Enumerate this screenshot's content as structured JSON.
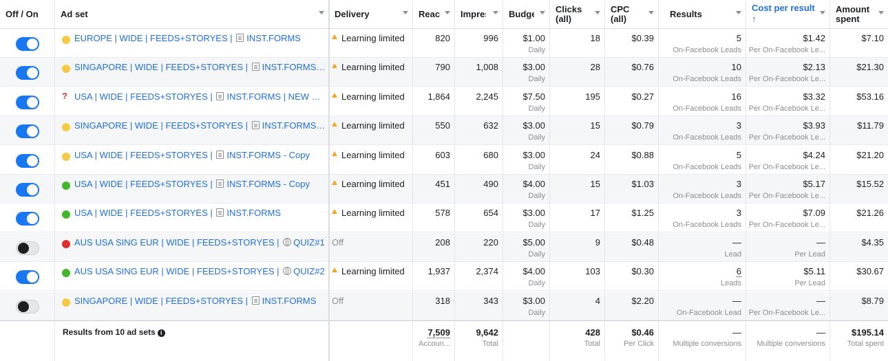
{
  "header": {
    "toggle": "Off / On",
    "adset": "Ad set",
    "delivery": "Delivery",
    "reach": "Reach",
    "impressions": "Impressions",
    "budget": "Budget",
    "clicks": "Clicks (all)",
    "cpc": "CPC (all)",
    "results": "Results",
    "cost_per_result": "Cost per result",
    "amount_spent": "Amount spent",
    "sort_arrow": "↑"
  },
  "colors": {
    "link": "#216fdb",
    "toggle_on": "#1877f2",
    "status_yellow": "#f7c844",
    "status_green": "#42b72a",
    "status_red": "#e02e2e",
    "warning": "#f5a623"
  },
  "rows": [
    {
      "on": true,
      "status": "yellow",
      "name_pre": "EUROPE | WIDE | FEEDS+STORYES |",
      "icon": "form",
      "name_post": "INST.FORMS",
      "delivery": "Learning limited",
      "delivery_warn": true,
      "reach": "820",
      "impressions": "996",
      "budget": "$1.00",
      "budget_sub": "Daily",
      "clicks": "18",
      "cpc": "$0.39",
      "results": "5",
      "results_sub": "On-Facebook Leads",
      "cpr": "$1.42",
      "cpr_sub": "Per On-Facebook Le...",
      "spent": "$7.10"
    },
    {
      "on": true,
      "status": "yellow",
      "name_pre": "SINGAPORE | WIDE | FEEDS+STORYES |",
      "icon": "form",
      "name_post": "INST.FORMS - Co...",
      "delivery": "Learning limited",
      "delivery_warn": true,
      "reach": "790",
      "impressions": "1,008",
      "budget": "$3.00",
      "budget_sub": "Daily",
      "clicks": "28",
      "cpc": "$0.76",
      "results": "10",
      "results_sub": "On-Facebook Leads",
      "cpr": "$2.13",
      "cpr_sub": "Per On-Facebook Le...",
      "spent": "$21.30"
    },
    {
      "on": true,
      "status": "question",
      "name_pre": "USA | WIDE | FEEDS+STORYES |",
      "icon": "form",
      "name_post": "INST.FORMS | NEW CREO",
      "delivery": "Learning limited",
      "delivery_warn": true,
      "reach": "1,864",
      "impressions": "2,245",
      "budget": "$7.50",
      "budget_sub": "Daily",
      "clicks": "195",
      "cpc": "$0.27",
      "results": "16",
      "results_sub": "On-Facebook Leads",
      "cpr": "$3.32",
      "cpr_sub": "Per On-Facebook Le...",
      "spent": "$53.16"
    },
    {
      "on": true,
      "status": "yellow",
      "name_pre": "SINGAPORE | WIDE | FEEDS+STORYES |",
      "icon": "form",
      "name_post": "INST.FORMS - Co...",
      "delivery": "Learning limited",
      "delivery_warn": true,
      "reach": "550",
      "impressions": "632",
      "budget": "$3.00",
      "budget_sub": "Daily",
      "clicks": "15",
      "cpc": "$0.79",
      "results": "3",
      "results_sub": "On-Facebook Leads",
      "cpr": "$3.93",
      "cpr_sub": "Per On-Facebook Le...",
      "spent": "$11.79"
    },
    {
      "on": true,
      "status": "yellow",
      "name_pre": "USA | WIDE | FEEDS+STORYES |",
      "icon": "form",
      "name_post": "INST.FORMS - Copy",
      "delivery": "Learning limited",
      "delivery_warn": true,
      "reach": "603",
      "impressions": "680",
      "budget": "$3.00",
      "budget_sub": "Daily",
      "clicks": "24",
      "cpc": "$0.88",
      "results": "5",
      "results_sub": "On-Facebook Leads",
      "cpr": "$4.24",
      "cpr_sub": "Per On-Facebook Le...",
      "spent": "$21.20"
    },
    {
      "on": true,
      "status": "green",
      "name_pre": "USA | WIDE | FEEDS+STORYES |",
      "icon": "form",
      "name_post": "INST.FORMS - Copy",
      "delivery": "Learning limited",
      "delivery_warn": true,
      "reach": "451",
      "impressions": "490",
      "budget": "$4.00",
      "budget_sub": "Daily",
      "clicks": "15",
      "cpc": "$1.03",
      "results": "3",
      "results_sub": "On-Facebook Leads",
      "cpr": "$5.17",
      "cpr_sub": "Per On-Facebook Le...",
      "spent": "$15.52"
    },
    {
      "on": true,
      "status": "green",
      "name_pre": "USA | WIDE | FEEDS+STORYES |",
      "icon": "form",
      "name_post": "INST.FORMS",
      "delivery": "Learning limited",
      "delivery_warn": true,
      "reach": "578",
      "impressions": "654",
      "budget": "$3.00",
      "budget_sub": "Daily",
      "clicks": "17",
      "cpc": "$1.25",
      "results": "3",
      "results_sub": "On-Facebook Leads",
      "cpr": "$7.09",
      "cpr_sub": "Per On-Facebook Le...",
      "spent": "$21.26"
    },
    {
      "on": false,
      "status": "red",
      "name_pre": "AUS USA SING EUR | WIDE | FEEDS+STORYES |",
      "icon": "globe",
      "name_post": "QUIZ#1",
      "delivery": "Off",
      "delivery_warn": false,
      "reach": "208",
      "impressions": "220",
      "budget": "$5.00",
      "budget_sub": "Daily",
      "clicks": "9",
      "cpc": "$0.48",
      "results": "—",
      "results_sub": "Lead",
      "cpr": "—",
      "cpr_sub": "Per Lead",
      "spent": "$4.35"
    },
    {
      "on": true,
      "status": "green",
      "name_pre": "AUS USA SING EUR | WIDE | FEEDS+STORYES |",
      "icon": "globe",
      "name_post": "QUIZ#2",
      "delivery": "Learning limited",
      "delivery_warn": true,
      "reach": "1,937",
      "impressions": "2,374",
      "budget": "$4.00",
      "budget_sub": "Daily",
      "clicks": "103",
      "cpc": "$0.30",
      "results": "6",
      "results_sub": "Leads",
      "results_dotted": true,
      "cpr": "$5.11",
      "cpr_sub": "Per Lead",
      "spent": "$30.67"
    },
    {
      "on": false,
      "status": "yellow",
      "name_pre": "SINGAPORE | WIDE | FEEDS+STORYES |",
      "icon": "form",
      "name_post": "INST.FORMS",
      "delivery": "Off",
      "delivery_warn": false,
      "reach": "318",
      "impressions": "343",
      "budget": "$3.00",
      "budget_sub": "Daily",
      "clicks": "4",
      "cpc": "$2.20",
      "results": "—",
      "results_sub": "On-Facebook Lead",
      "cpr": "—",
      "cpr_sub": "Per On-Facebook Le...",
      "spent": "$8.79"
    }
  ],
  "footer": {
    "label": "Results from 10 ad sets",
    "info_icon": "i",
    "reach": "7,509",
    "reach_sub": "Accoun...",
    "impressions": "9,642",
    "impressions_sub": "Total",
    "clicks": "428",
    "clicks_sub": "Total",
    "cpc": "$0.46",
    "cpc_sub": "Per Click",
    "results": "—",
    "results_sub": "Multiple conversions",
    "cpr": "—",
    "cpr_sub": "Multiple conversions",
    "spent": "$195.14",
    "spent_sub": "Total spent"
  }
}
